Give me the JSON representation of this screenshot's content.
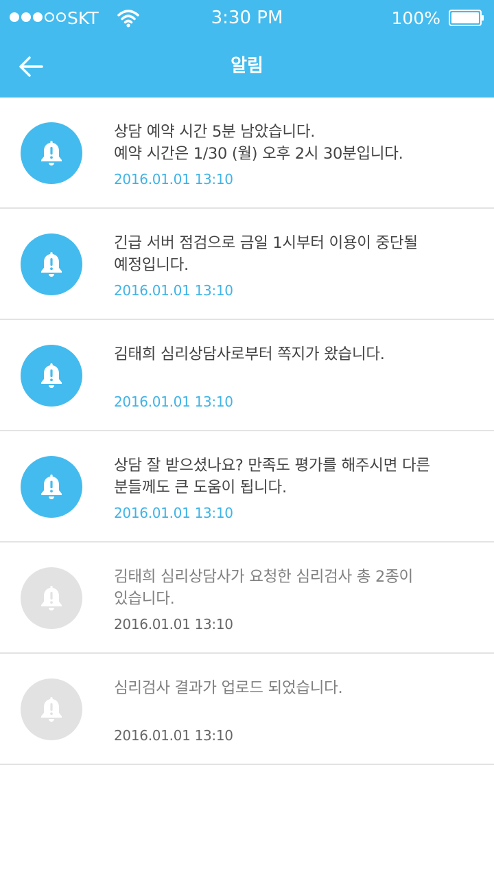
{
  "status_bar": {
    "carrier": "SKT",
    "time": "3:30 PM",
    "battery": "100%",
    "signal_icon": "signal-dots-icon",
    "wifi_icon": "wifi-icon",
    "battery_icon": "battery-icon"
  },
  "header": {
    "title": "알림",
    "back_icon": "arrow-left-icon"
  },
  "colors": {
    "header_bg": "#44bbee",
    "unread_icon_bg": "#44bbee",
    "read_icon_bg": "#e2e2e2",
    "unread_date": "#3fb3e6",
    "read_date": "#666666"
  },
  "notifications": [
    {
      "line1": "상담 예약 시간 5분 남았습니다.",
      "line2": "예약 시간은 1/30 (월) 오후 2시 30분입니다.",
      "date": "2016.01.01 13:10",
      "read": false,
      "icon": "bell-alert-icon"
    },
    {
      "line1": "긴급 서버 점검으로 금일 1시부터 이용이 중단될",
      "line2": "예정입니다.",
      "date": "2016.01.01 13:10",
      "read": false,
      "icon": "bell-alert-icon"
    },
    {
      "line1": "김태희 심리상담사로부터 쪽지가 왔습니다.",
      "line2": "",
      "date": "2016.01.01 13:10",
      "read": false,
      "icon": "bell-alert-icon"
    },
    {
      "line1": "상담 잘 받으셨나요? 만족도 평가를 해주시면 다른",
      "line2": "분들께도 큰 도움이 됩니다.",
      "date": "2016.01.01 13:10",
      "read": false,
      "icon": "bell-alert-icon"
    },
    {
      "line1": "김태희 심리상담사가 요청한 심리검사 총 2종이",
      "line2": "있습니다.",
      "date": "2016.01.01 13:10",
      "read": true,
      "icon": "bell-alert-icon"
    },
    {
      "line1": "심리검사 결과가 업로드 되었습니다.",
      "line2": "",
      "date": "2016.01.01 13:10",
      "read": true,
      "icon": "bell-alert-icon"
    }
  ]
}
